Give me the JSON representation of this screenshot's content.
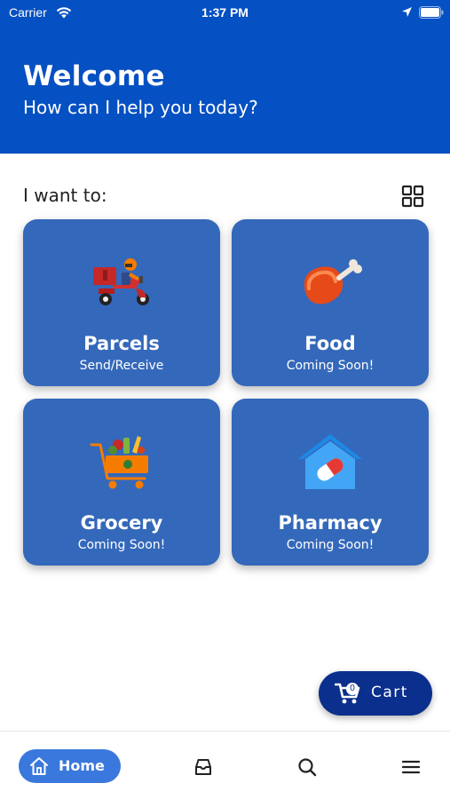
{
  "status_bar": {
    "carrier": "Carrier",
    "time": "1:37 PM"
  },
  "header": {
    "title": "Welcome",
    "subtitle": "How can I help you today?"
  },
  "section": {
    "heading": "I want to:"
  },
  "services": [
    {
      "title": "Parcels",
      "subtitle": "Send/Receive",
      "icon": "delivery-scooter-icon"
    },
    {
      "title": "Food",
      "subtitle": "Coming Soon!",
      "icon": "chicken-leg-icon"
    },
    {
      "title": "Grocery",
      "subtitle": "Coming Soon!",
      "icon": "grocery-cart-icon"
    },
    {
      "title": "Pharmacy",
      "subtitle": "Coming Soon!",
      "icon": "pharmacy-pill-house-icon"
    }
  ],
  "cart": {
    "count": "0",
    "label": "Cart"
  },
  "bottom_nav": {
    "home_label": "Home"
  },
  "colors": {
    "header": "#0550c2",
    "tile": "#3468ba",
    "cart": "#0b2f8c",
    "nav_active": "#3a78dd"
  }
}
